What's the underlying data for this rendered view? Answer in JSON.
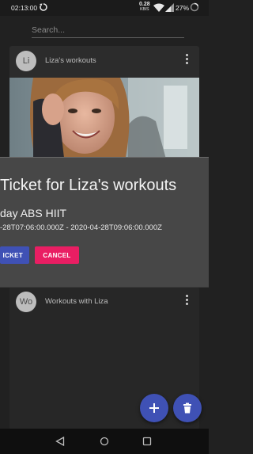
{
  "status_bar": {
    "time": "02:13:00",
    "network_speed": "0.28",
    "network_unit": "KB/S",
    "battery": "27%"
  },
  "search": {
    "placeholder": "Search..."
  },
  "cards": [
    {
      "avatar": "Li",
      "title": "Liza's workouts"
    },
    {
      "avatar": "Wo",
      "title": "Workouts with Liza"
    }
  ],
  "dialog": {
    "title": "Ticket for Liza's workouts",
    "subtitle": "day ABS HIIT",
    "dates": "-28T07:06:00.000Z - 2020-04-28T09:06:00.000Z",
    "ticket_button": "ICKET",
    "cancel_button": "CANCEL"
  },
  "colors": {
    "primary": "#3f51b5",
    "accent": "#e91e63",
    "background": "#212121",
    "dialog": "#474747"
  },
  "icons": {
    "fab_add": "plus-icon",
    "fab_delete": "trash-icon",
    "nav_back": "back-triangle-icon",
    "nav_home": "home-circle-icon",
    "nav_recents": "recents-square-icon"
  }
}
